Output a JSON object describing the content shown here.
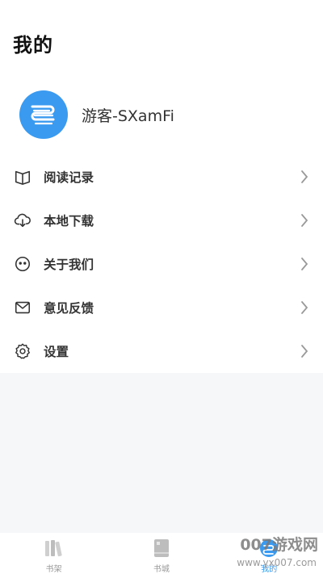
{
  "header": {
    "title": "我的"
  },
  "profile": {
    "username": "游客-SXamFi",
    "avatar_icon": "wave-logo-icon",
    "avatar_color": "#3a9af0"
  },
  "menu": {
    "items": [
      {
        "label": "阅读记录",
        "icon": "book-open-icon"
      },
      {
        "label": "本地下载",
        "icon": "cloud-download-icon"
      },
      {
        "label": "关于我们",
        "icon": "smiley-icon"
      },
      {
        "label": "意见反馈",
        "icon": "mail-icon"
      },
      {
        "label": "设置",
        "icon": "gear-icon"
      }
    ]
  },
  "tabbar": {
    "tabs": [
      {
        "label": "书架",
        "icon": "bookshelf-icon",
        "active": false
      },
      {
        "label": "书城",
        "icon": "book-store-icon",
        "active": false
      },
      {
        "label": "我的",
        "icon": "profile-icon",
        "active": true
      }
    ]
  },
  "watermark": {
    "text": "007游戏网",
    "url": "www.yx007.com"
  },
  "colors": {
    "accent": "#3a9af0",
    "background": "#f6f7f9",
    "text": "#333333"
  }
}
